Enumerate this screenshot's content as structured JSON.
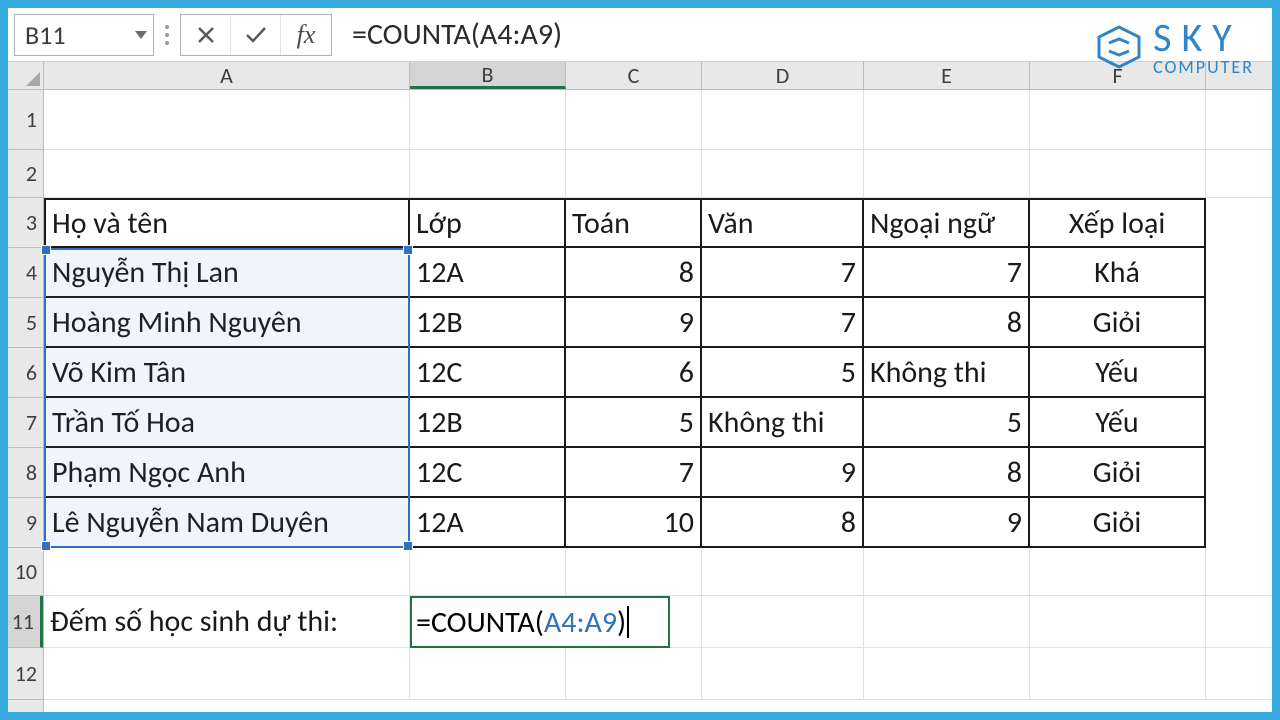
{
  "name_box": "B11",
  "formula_bar": "=COUNTA(A4:A9)",
  "logo": {
    "sky": "SKY",
    "sub": "COMPUTER"
  },
  "columns": [
    "A",
    "B",
    "C",
    "D",
    "E",
    "F"
  ],
  "row_heights": {
    "1": 60,
    "2": 48,
    "3": 50,
    "4": 50,
    "5": 50,
    "6": 50,
    "7": 50,
    "8": 50,
    "9": 50,
    "10": 48,
    "11": 52,
    "12": 52
  },
  "headers": {
    "A": "Họ và tên",
    "B": "Lớp",
    "C": "Toán",
    "D": "Văn",
    "E": "Ngoại ngữ",
    "F": "Xếp loại"
  },
  "students": [
    {
      "name": "Nguyễn Thị Lan",
      "class": "12A",
      "math": "8",
      "lit": "7",
      "lang": "7",
      "grade": "Khá"
    },
    {
      "name": "Hoàng Minh Nguyên",
      "class": "12B",
      "math": "9",
      "lit": "7",
      "lang": "8",
      "grade": "Giỏi"
    },
    {
      "name": "Võ Kim Tân",
      "class": "12C",
      "math": "6",
      "lit": "5",
      "lang": "Không thi",
      "grade": "Yếu"
    },
    {
      "name": "Trần Tố Hoa",
      "class": "12B",
      "math": "5",
      "lit": "Không thi",
      "lang": "5",
      "grade": "Yếu"
    },
    {
      "name": "Phạm Ngọc Anh",
      "class": "12C",
      "math": "7",
      "lit": "9",
      "lang": "8",
      "grade": "Giỏi"
    },
    {
      "name": "Lê Nguyễn Nam Duyên",
      "class": "12A",
      "math": "10",
      "lit": "8",
      "lang": "9",
      "grade": "Giỏi"
    }
  ],
  "summary_label": "Đếm số học sinh dự thi:",
  "editing_formula_prefix": "=COUNTA(",
  "editing_formula_ref": "A4:A9",
  "editing_formula_suffix": ")"
}
